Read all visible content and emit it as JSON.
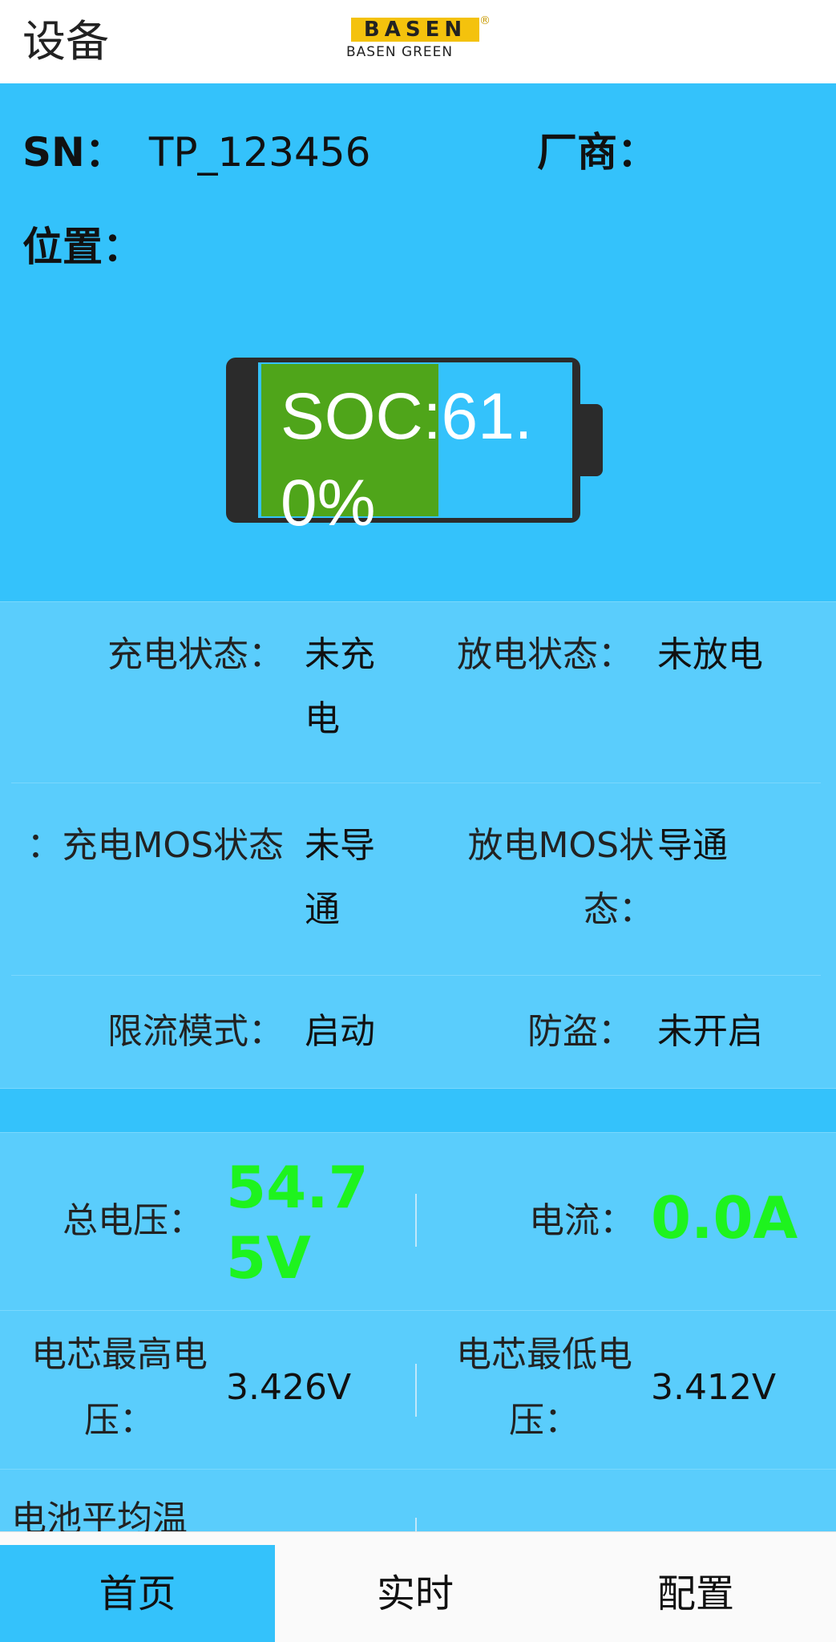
{
  "header": {
    "title": "设备",
    "logo_top": "BASEN",
    "logo_reg": "®",
    "logo_bottom": "BASEN GREEN"
  },
  "device_info": {
    "sn_label": "SN：",
    "sn_value": "TP_123456",
    "vendor_label": "厂商：",
    "vendor_value": "",
    "location_label": "位置：",
    "location_value": ""
  },
  "battery": {
    "soc_text": "SOC:61.0%",
    "soc_fraction": 0.61,
    "fill_color": "#4fa51a"
  },
  "status": {
    "charge_state_label": "充电状态：",
    "charge_state_value": "未充电",
    "discharge_state_label": "放电状态：",
    "discharge_state_value": "未放电",
    "charge_mos_label": "充电MOS状态：",
    "charge_mos_value": "未导通",
    "discharge_mos_label": "放电MOS状态：",
    "discharge_mos_value": "导通",
    "current_limit_label": "限流模式：",
    "current_limit_value": "启动",
    "anti_theft_label": "防盗：",
    "anti_theft_value": "未开启"
  },
  "measurements": {
    "total_voltage_label": "总电压：",
    "total_voltage_value": "54.75V",
    "current_label": "电流：",
    "current_value": "0.0A",
    "cell_max_voltage_label": "电芯最高电压：",
    "cell_max_voltage_value": "3.426V",
    "cell_min_voltage_label": "电芯最低电压：",
    "cell_min_voltage_value": "3.412V",
    "avg_temp_label": "电池平均温",
    "value_color": "#1ef31e"
  },
  "tabs": [
    {
      "label": "首页",
      "active": true
    },
    {
      "label": "实时",
      "active": false
    },
    {
      "label": "配置",
      "active": false
    }
  ],
  "colors": {
    "background": "#34c2fb",
    "panel": "#5acdfc",
    "header": "#ffffff"
  }
}
